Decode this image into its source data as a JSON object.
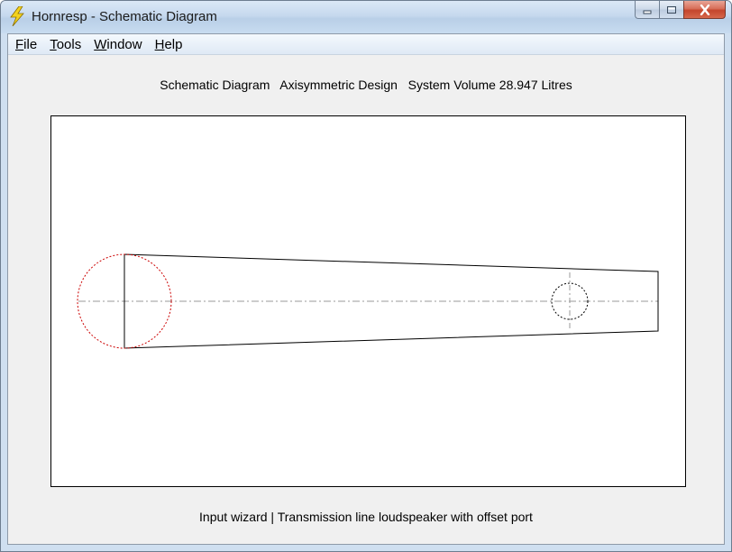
{
  "window": {
    "title": "Hornresp - Schematic Diagram",
    "icon": "lightning-bolt-icon"
  },
  "caption_buttons": {
    "minimize_icon": "minimize-icon",
    "maximize_icon": "maximize-icon",
    "close_icon": "close-icon"
  },
  "menu": {
    "items": [
      {
        "label": "File"
      },
      {
        "label": "Tools"
      },
      {
        "label": "Window"
      },
      {
        "label": "Help"
      }
    ]
  },
  "header": {
    "text": "Schematic Diagram   Axisymmetric Design   System Volume 28.947 Litres"
  },
  "diagram": {
    "driver_circle_color": "#cc0000",
    "port_circle_color": "#000000",
    "line_color": "#000000",
    "centerline_color": "#999999"
  },
  "footer": {
    "text": "Input wizard | Transmission line loudspeaker with offset port"
  }
}
